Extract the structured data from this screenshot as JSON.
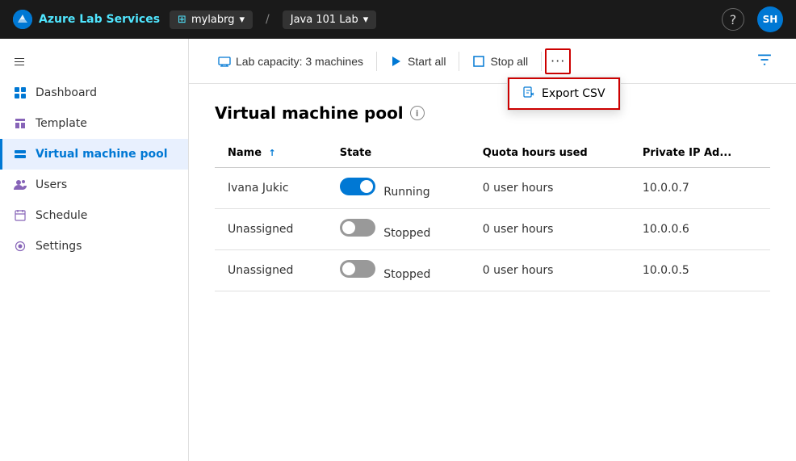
{
  "topnav": {
    "brand_azure": "Azure",
    "brand_rest": " Lab Services",
    "breadcrumb_org": "mylabrg",
    "breadcrumb_slash": "/",
    "breadcrumb_lab": "Java 101 Lab",
    "help_label": "?",
    "avatar_label": "SH"
  },
  "sidebar": {
    "collapse_title": "Collapse sidebar",
    "items": [
      {
        "id": "dashboard",
        "label": "Dashboard"
      },
      {
        "id": "template",
        "label": "Template"
      },
      {
        "id": "virtual-machine-pool",
        "label": "Virtual machine pool",
        "active": true
      },
      {
        "id": "users",
        "label": "Users"
      },
      {
        "id": "schedule",
        "label": "Schedule"
      },
      {
        "id": "settings",
        "label": "Settings"
      }
    ]
  },
  "toolbar": {
    "capacity_label": "Lab capacity: 3 machines",
    "start_all_label": "Start all",
    "stop_all_label": "Stop all",
    "more_label": "···",
    "export_csv_label": "Export CSV",
    "filter_label": "Filter"
  },
  "main": {
    "page_title": "Virtual machine pool",
    "columns": {
      "name": "Name",
      "state": "State",
      "quota": "Quota hours used",
      "ip": "Private IP Ad..."
    },
    "rows": [
      {
        "name": "Ivana Jukic",
        "state": "Running",
        "state_on": true,
        "quota": "0 user hours",
        "ip": "10.0.0.7"
      },
      {
        "name": "Unassigned",
        "state": "Stopped",
        "state_on": false,
        "quota": "0 user hours",
        "ip": "10.0.0.6"
      },
      {
        "name": "Unassigned",
        "state": "Stopped",
        "state_on": false,
        "quota": "0 user hours",
        "ip": "10.0.0.5"
      }
    ]
  }
}
